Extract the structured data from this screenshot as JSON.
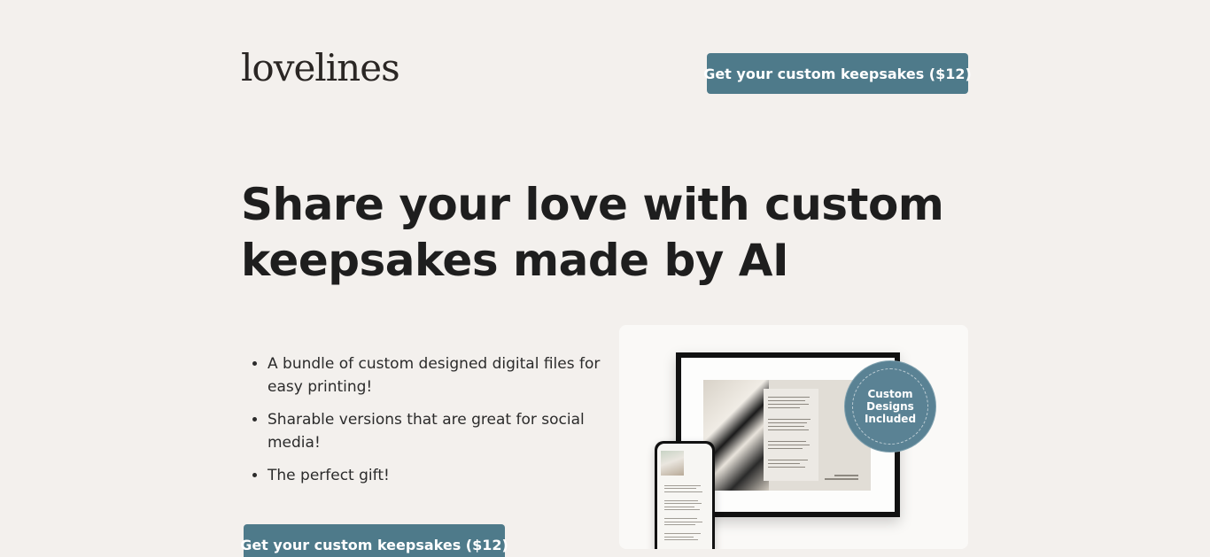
{
  "header": {
    "logo_text": "lovelines",
    "cta_label": "Get your custom keepsakes ($12)"
  },
  "hero": {
    "headline": "Share your love with custom keepsakes made by AI",
    "features": [
      "A bundle of custom designed digital files for easy printing!",
      "Sharable versions that are great for social media!",
      "The perfect gift!"
    ],
    "cta_label": "Get your custom keepsakes ($12)"
  },
  "showcase": {
    "badge_text": "Custom Designs Included"
  },
  "colors": {
    "background": "#f3f0ed",
    "accent": "#4e7a8a",
    "badge": "#5a8294",
    "text": "#1e1e1e"
  }
}
